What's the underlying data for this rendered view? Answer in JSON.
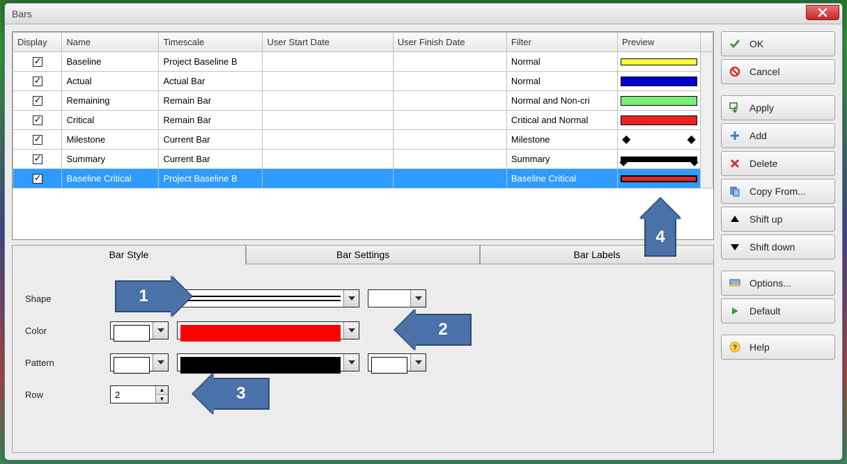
{
  "window": {
    "title": "Bars"
  },
  "columns": {
    "display": "Display",
    "name": "Name",
    "timescale": "Timescale",
    "user_start": "User Start Date",
    "user_finish": "User Finish Date",
    "filter": "Filter",
    "preview": "Preview"
  },
  "rows": [
    {
      "display": true,
      "name": "Baseline",
      "timescale": "Project Baseline B",
      "user_start": "",
      "user_finish": "",
      "filter": "Normal",
      "preview": "yellow",
      "selected": false
    },
    {
      "display": true,
      "name": "Actual",
      "timescale": "Actual Bar",
      "user_start": "",
      "user_finish": "",
      "filter": "Normal",
      "preview": "blue",
      "selected": false
    },
    {
      "display": true,
      "name": "Remaining",
      "timescale": "Remain Bar",
      "user_start": "",
      "user_finish": "",
      "filter": "Normal and Non-cri",
      "preview": "lightgreen",
      "selected": false
    },
    {
      "display": true,
      "name": "Critical",
      "timescale": "Remain Bar",
      "user_start": "",
      "user_finish": "",
      "filter": "Critical and Normal",
      "preview": "red",
      "selected": false
    },
    {
      "display": true,
      "name": "Milestone",
      "timescale": "Current Bar",
      "user_start": "",
      "user_finish": "",
      "filter": "Milestone",
      "preview": "milestone",
      "selected": false
    },
    {
      "display": true,
      "name": "Summary",
      "timescale": "Current Bar",
      "user_start": "",
      "user_finish": "",
      "filter": "Summary",
      "preview": "summary",
      "selected": false
    },
    {
      "display": true,
      "name": "Baseline Critical",
      "timescale": "Project Baseline B",
      "user_start": "",
      "user_finish": "",
      "filter": "Baseline Critical",
      "preview": "red-outline",
      "selected": true
    }
  ],
  "tabs": {
    "style": "Bar Style",
    "settings": "Bar Settings",
    "labels": "Bar Labels"
  },
  "form": {
    "shape_label": "Shape",
    "color_label": "Color",
    "pattern_label": "Pattern",
    "row_label": "Row",
    "row_value": "2"
  },
  "buttons": {
    "ok": "OK",
    "cancel": "Cancel",
    "apply": "Apply",
    "add": "Add",
    "delete": "Delete",
    "copy_from": "Copy From...",
    "shift_up": "Shift up",
    "shift_down": "Shift down",
    "options": "Options...",
    "default": "Default",
    "help": "Help"
  },
  "annotations": {
    "a1": "1",
    "a2": "2",
    "a3": "3",
    "a4": "4"
  }
}
